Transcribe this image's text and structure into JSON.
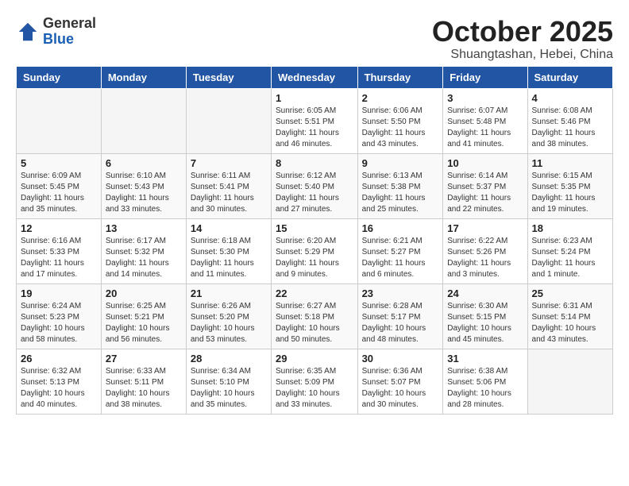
{
  "logo": {
    "general": "General",
    "blue": "Blue"
  },
  "header": {
    "month": "October 2025",
    "location": "Shuangtashan, Hebei, China"
  },
  "weekdays": [
    "Sunday",
    "Monday",
    "Tuesday",
    "Wednesday",
    "Thursday",
    "Friday",
    "Saturday"
  ],
  "weeks": [
    [
      {
        "day": "",
        "info": ""
      },
      {
        "day": "",
        "info": ""
      },
      {
        "day": "",
        "info": ""
      },
      {
        "day": "1",
        "info": "Sunrise: 6:05 AM\nSunset: 5:51 PM\nDaylight: 11 hours\nand 46 minutes."
      },
      {
        "day": "2",
        "info": "Sunrise: 6:06 AM\nSunset: 5:50 PM\nDaylight: 11 hours\nand 43 minutes."
      },
      {
        "day": "3",
        "info": "Sunrise: 6:07 AM\nSunset: 5:48 PM\nDaylight: 11 hours\nand 41 minutes."
      },
      {
        "day": "4",
        "info": "Sunrise: 6:08 AM\nSunset: 5:46 PM\nDaylight: 11 hours\nand 38 minutes."
      }
    ],
    [
      {
        "day": "5",
        "info": "Sunrise: 6:09 AM\nSunset: 5:45 PM\nDaylight: 11 hours\nand 35 minutes."
      },
      {
        "day": "6",
        "info": "Sunrise: 6:10 AM\nSunset: 5:43 PM\nDaylight: 11 hours\nand 33 minutes."
      },
      {
        "day": "7",
        "info": "Sunrise: 6:11 AM\nSunset: 5:41 PM\nDaylight: 11 hours\nand 30 minutes."
      },
      {
        "day": "8",
        "info": "Sunrise: 6:12 AM\nSunset: 5:40 PM\nDaylight: 11 hours\nand 27 minutes."
      },
      {
        "day": "9",
        "info": "Sunrise: 6:13 AM\nSunset: 5:38 PM\nDaylight: 11 hours\nand 25 minutes."
      },
      {
        "day": "10",
        "info": "Sunrise: 6:14 AM\nSunset: 5:37 PM\nDaylight: 11 hours\nand 22 minutes."
      },
      {
        "day": "11",
        "info": "Sunrise: 6:15 AM\nSunset: 5:35 PM\nDaylight: 11 hours\nand 19 minutes."
      }
    ],
    [
      {
        "day": "12",
        "info": "Sunrise: 6:16 AM\nSunset: 5:33 PM\nDaylight: 11 hours\nand 17 minutes."
      },
      {
        "day": "13",
        "info": "Sunrise: 6:17 AM\nSunset: 5:32 PM\nDaylight: 11 hours\nand 14 minutes."
      },
      {
        "day": "14",
        "info": "Sunrise: 6:18 AM\nSunset: 5:30 PM\nDaylight: 11 hours\nand 11 minutes."
      },
      {
        "day": "15",
        "info": "Sunrise: 6:20 AM\nSunset: 5:29 PM\nDaylight: 11 hours\nand 9 minutes."
      },
      {
        "day": "16",
        "info": "Sunrise: 6:21 AM\nSunset: 5:27 PM\nDaylight: 11 hours\nand 6 minutes."
      },
      {
        "day": "17",
        "info": "Sunrise: 6:22 AM\nSunset: 5:26 PM\nDaylight: 11 hours\nand 3 minutes."
      },
      {
        "day": "18",
        "info": "Sunrise: 6:23 AM\nSunset: 5:24 PM\nDaylight: 11 hours\nand 1 minute."
      }
    ],
    [
      {
        "day": "19",
        "info": "Sunrise: 6:24 AM\nSunset: 5:23 PM\nDaylight: 10 hours\nand 58 minutes."
      },
      {
        "day": "20",
        "info": "Sunrise: 6:25 AM\nSunset: 5:21 PM\nDaylight: 10 hours\nand 56 minutes."
      },
      {
        "day": "21",
        "info": "Sunrise: 6:26 AM\nSunset: 5:20 PM\nDaylight: 10 hours\nand 53 minutes."
      },
      {
        "day": "22",
        "info": "Sunrise: 6:27 AM\nSunset: 5:18 PM\nDaylight: 10 hours\nand 50 minutes."
      },
      {
        "day": "23",
        "info": "Sunrise: 6:28 AM\nSunset: 5:17 PM\nDaylight: 10 hours\nand 48 minutes."
      },
      {
        "day": "24",
        "info": "Sunrise: 6:30 AM\nSunset: 5:15 PM\nDaylight: 10 hours\nand 45 minutes."
      },
      {
        "day": "25",
        "info": "Sunrise: 6:31 AM\nSunset: 5:14 PM\nDaylight: 10 hours\nand 43 minutes."
      }
    ],
    [
      {
        "day": "26",
        "info": "Sunrise: 6:32 AM\nSunset: 5:13 PM\nDaylight: 10 hours\nand 40 minutes."
      },
      {
        "day": "27",
        "info": "Sunrise: 6:33 AM\nSunset: 5:11 PM\nDaylight: 10 hours\nand 38 minutes."
      },
      {
        "day": "28",
        "info": "Sunrise: 6:34 AM\nSunset: 5:10 PM\nDaylight: 10 hours\nand 35 minutes."
      },
      {
        "day": "29",
        "info": "Sunrise: 6:35 AM\nSunset: 5:09 PM\nDaylight: 10 hours\nand 33 minutes."
      },
      {
        "day": "30",
        "info": "Sunrise: 6:36 AM\nSunset: 5:07 PM\nDaylight: 10 hours\nand 30 minutes."
      },
      {
        "day": "31",
        "info": "Sunrise: 6:38 AM\nSunset: 5:06 PM\nDaylight: 10 hours\nand 28 minutes."
      },
      {
        "day": "",
        "info": ""
      }
    ]
  ]
}
